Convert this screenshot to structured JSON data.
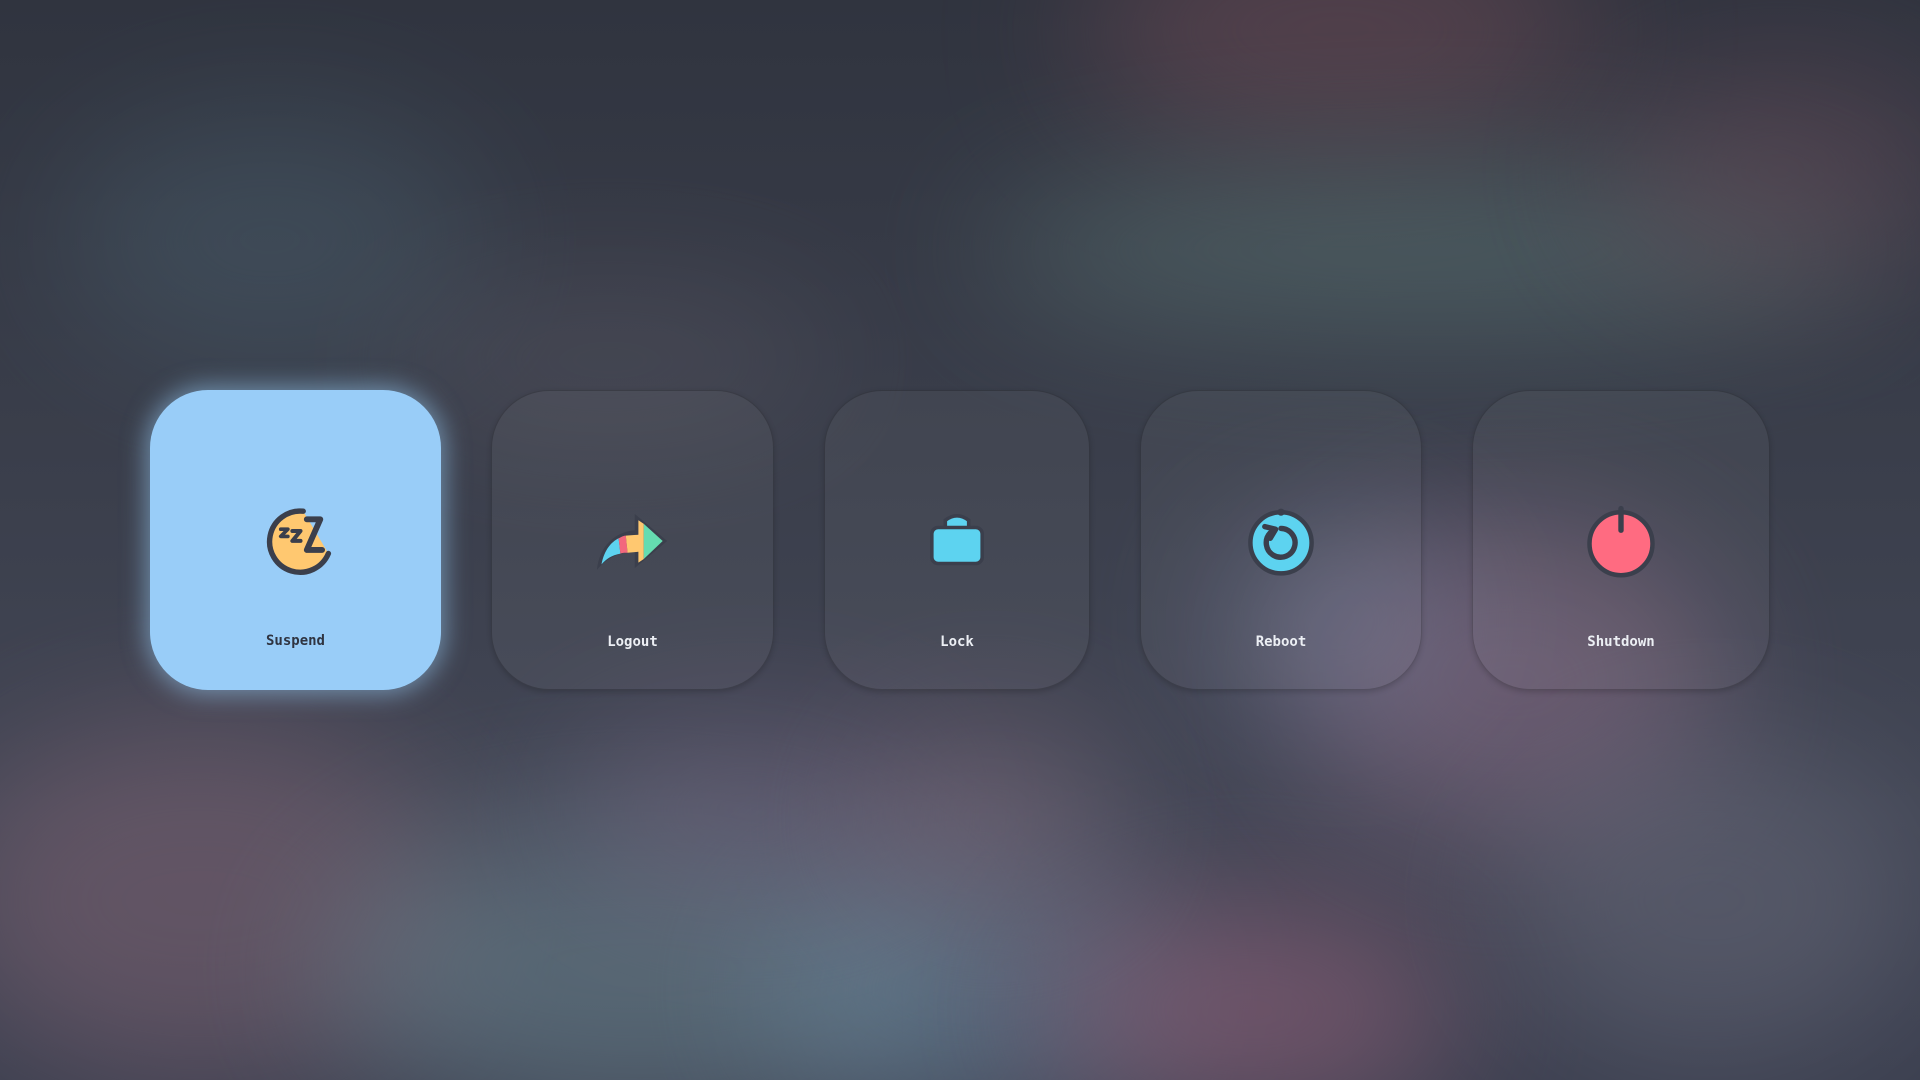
{
  "power_menu": {
    "options": [
      {
        "id": "suspend",
        "label": "Suspend",
        "icon": "sleep-moon-icon",
        "selected": true
      },
      {
        "id": "logout",
        "label": "Logout",
        "icon": "logout-arrow-icon",
        "selected": false
      },
      {
        "id": "lock",
        "label": "Lock",
        "icon": "padlock-icon",
        "selected": false
      },
      {
        "id": "reboot",
        "label": "Reboot",
        "icon": "reboot-icon",
        "selected": false
      },
      {
        "id": "shutdown",
        "label": "Shutdown",
        "icon": "power-icon",
        "selected": false
      }
    ]
  },
  "colors": {
    "selected_background": "#99cdf8",
    "moon": "#ffc870",
    "lock": "#5dd3f0",
    "reboot": "#5dd3f0",
    "shutdown": "#ff6b81",
    "outline": "#3b3f4c",
    "arrow_pink": "#f2687d",
    "arrow_yellow": "#ffc870",
    "arrow_green": "#65dcb0",
    "arrow_blue": "#5dd3f0"
  }
}
